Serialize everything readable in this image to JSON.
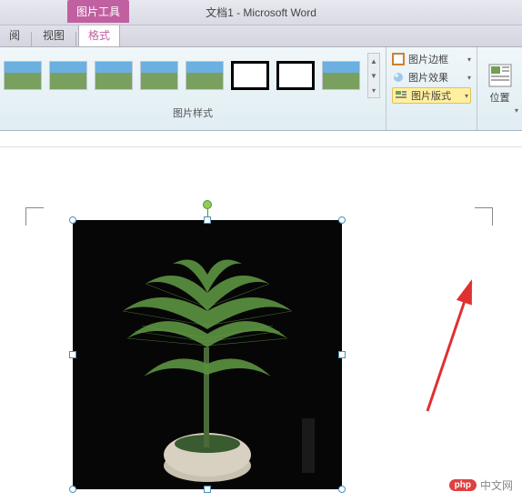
{
  "titlebar": {
    "context_tab": "图片工具",
    "document_title": "文档1 - Microsoft Word"
  },
  "tabs": {
    "items": [
      "阅",
      "视图",
      "格式"
    ],
    "active_index": 2
  },
  "ribbon": {
    "styles_group_label": "图片样式",
    "options": {
      "border": "图片边框",
      "effects": "图片效果",
      "layout": "图片版式"
    },
    "position_label": "位置"
  },
  "watermark": {
    "badge": "php",
    "text": "中文网"
  }
}
